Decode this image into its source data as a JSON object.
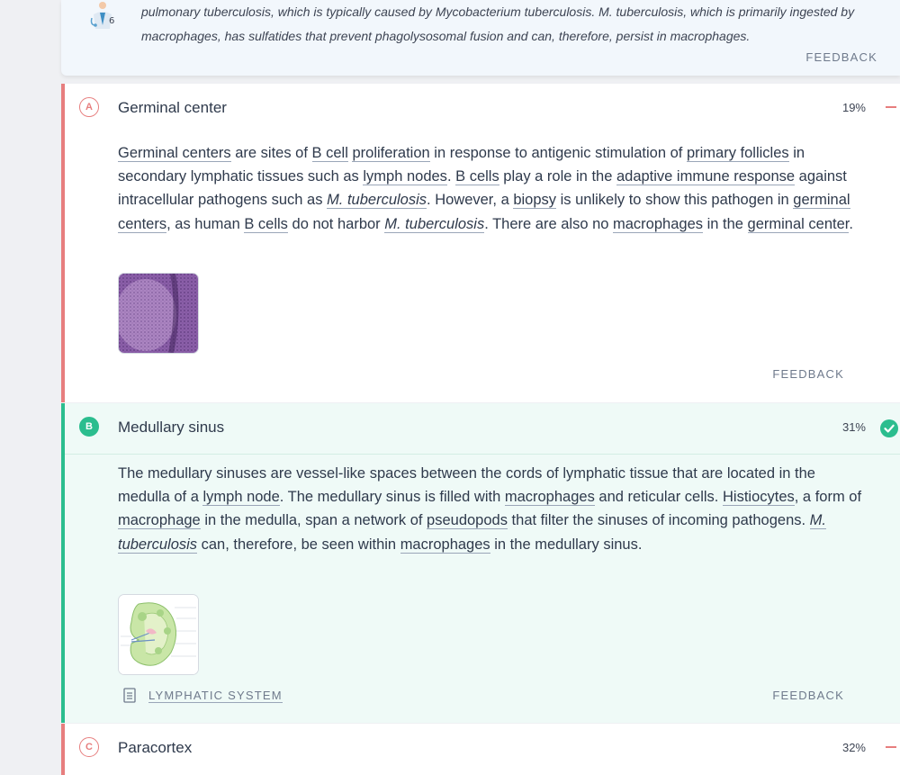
{
  "top": {
    "line1": "pulmonary tuberculosis, which is typically caused by Mycobacterium tuberculosis. M. tuberculosis, which is primarily ingested by",
    "line2": "macrophages, has sulfatides that prevent phagolysosomal fusion and can, therefore, persist in macrophages.",
    "feedback": "FEEDBACK"
  },
  "choices": [
    {
      "letter": "A",
      "label": "Germinal center",
      "percent": "19%",
      "status": "incorrect",
      "feedback": "FEEDBACK",
      "explanation": [
        {
          "t": "Germinal centers",
          "link": true
        },
        {
          "t": " are sites of "
        },
        {
          "t": "B cell",
          "link": true
        },
        {
          "t": " "
        },
        {
          "t": "proliferation",
          "link": true
        },
        {
          "t": " in response to antigenic stimulation of "
        },
        {
          "t": "primary follicles",
          "link": true
        },
        {
          "t": " in secondary lymphatic tissues such as "
        },
        {
          "t": "lymph nodes",
          "link": true
        },
        {
          "t": ". "
        },
        {
          "t": "B cells",
          "link": true
        },
        {
          "t": " play a role in the "
        },
        {
          "t": "adaptive immune response",
          "link": true
        },
        {
          "t": " against intracellular pathogens such as "
        },
        {
          "t": "M. tuberculosis",
          "link": true,
          "italic": true
        },
        {
          "t": ". However, a "
        },
        {
          "t": "biopsy",
          "link": true
        },
        {
          "t": " is unlikely to show this pathogen in "
        },
        {
          "t": "germinal centers",
          "link": true
        },
        {
          "t": ", as human "
        },
        {
          "t": "B cells",
          "link": true
        },
        {
          "t": " do not harbor "
        },
        {
          "t": "M. tuberculosis",
          "link": true,
          "italic": true
        },
        {
          "t": ". There are also no "
        },
        {
          "t": "macrophages",
          "link": true
        },
        {
          "t": " in the "
        },
        {
          "t": "germinal center",
          "link": true
        },
        {
          "t": "."
        }
      ]
    },
    {
      "letter": "B",
      "label": "Medullary sinus",
      "percent": "31%",
      "status": "correct",
      "feedback": "FEEDBACK",
      "topic": "LYMPHATIC SYSTEM",
      "explanation": [
        {
          "t": "The medullary sinuses are vessel-like spaces between the cords of lymphatic tissue that are located in the medulla of a "
        },
        {
          "t": "lymph node",
          "link": true
        },
        {
          "t": ". The medullary sinus is filled with "
        },
        {
          "t": "macrophages",
          "link": true
        },
        {
          "t": " and reticular cells. "
        },
        {
          "t": "Histiocytes",
          "link": true
        },
        {
          "t": ", a form of "
        },
        {
          "t": "macrophage",
          "link": true
        },
        {
          "t": " in the medulla, span a network of "
        },
        {
          "t": "pseudopods",
          "link": true
        },
        {
          "t": " that filter the sinuses of incoming pathogens. "
        },
        {
          "t": "M. tuberculosis",
          "link": true,
          "italic": true
        },
        {
          "t": " can, therefore, be seen within "
        },
        {
          "t": "macrophages",
          "link": true
        },
        {
          "t": " in the medullary sinus."
        }
      ]
    },
    {
      "letter": "C",
      "label": "Paracortex",
      "percent": "32%",
      "status": "incorrect"
    }
  ],
  "colors": {
    "incorrect": "#e77e7e",
    "correct": "#2bbd8e",
    "correct_bg": "#effaf7"
  },
  "icons": {
    "top": "doctor-illustration-icon",
    "correct": "check-circle-icon",
    "incorrect": "minus-icon",
    "topic": "document-icon"
  }
}
